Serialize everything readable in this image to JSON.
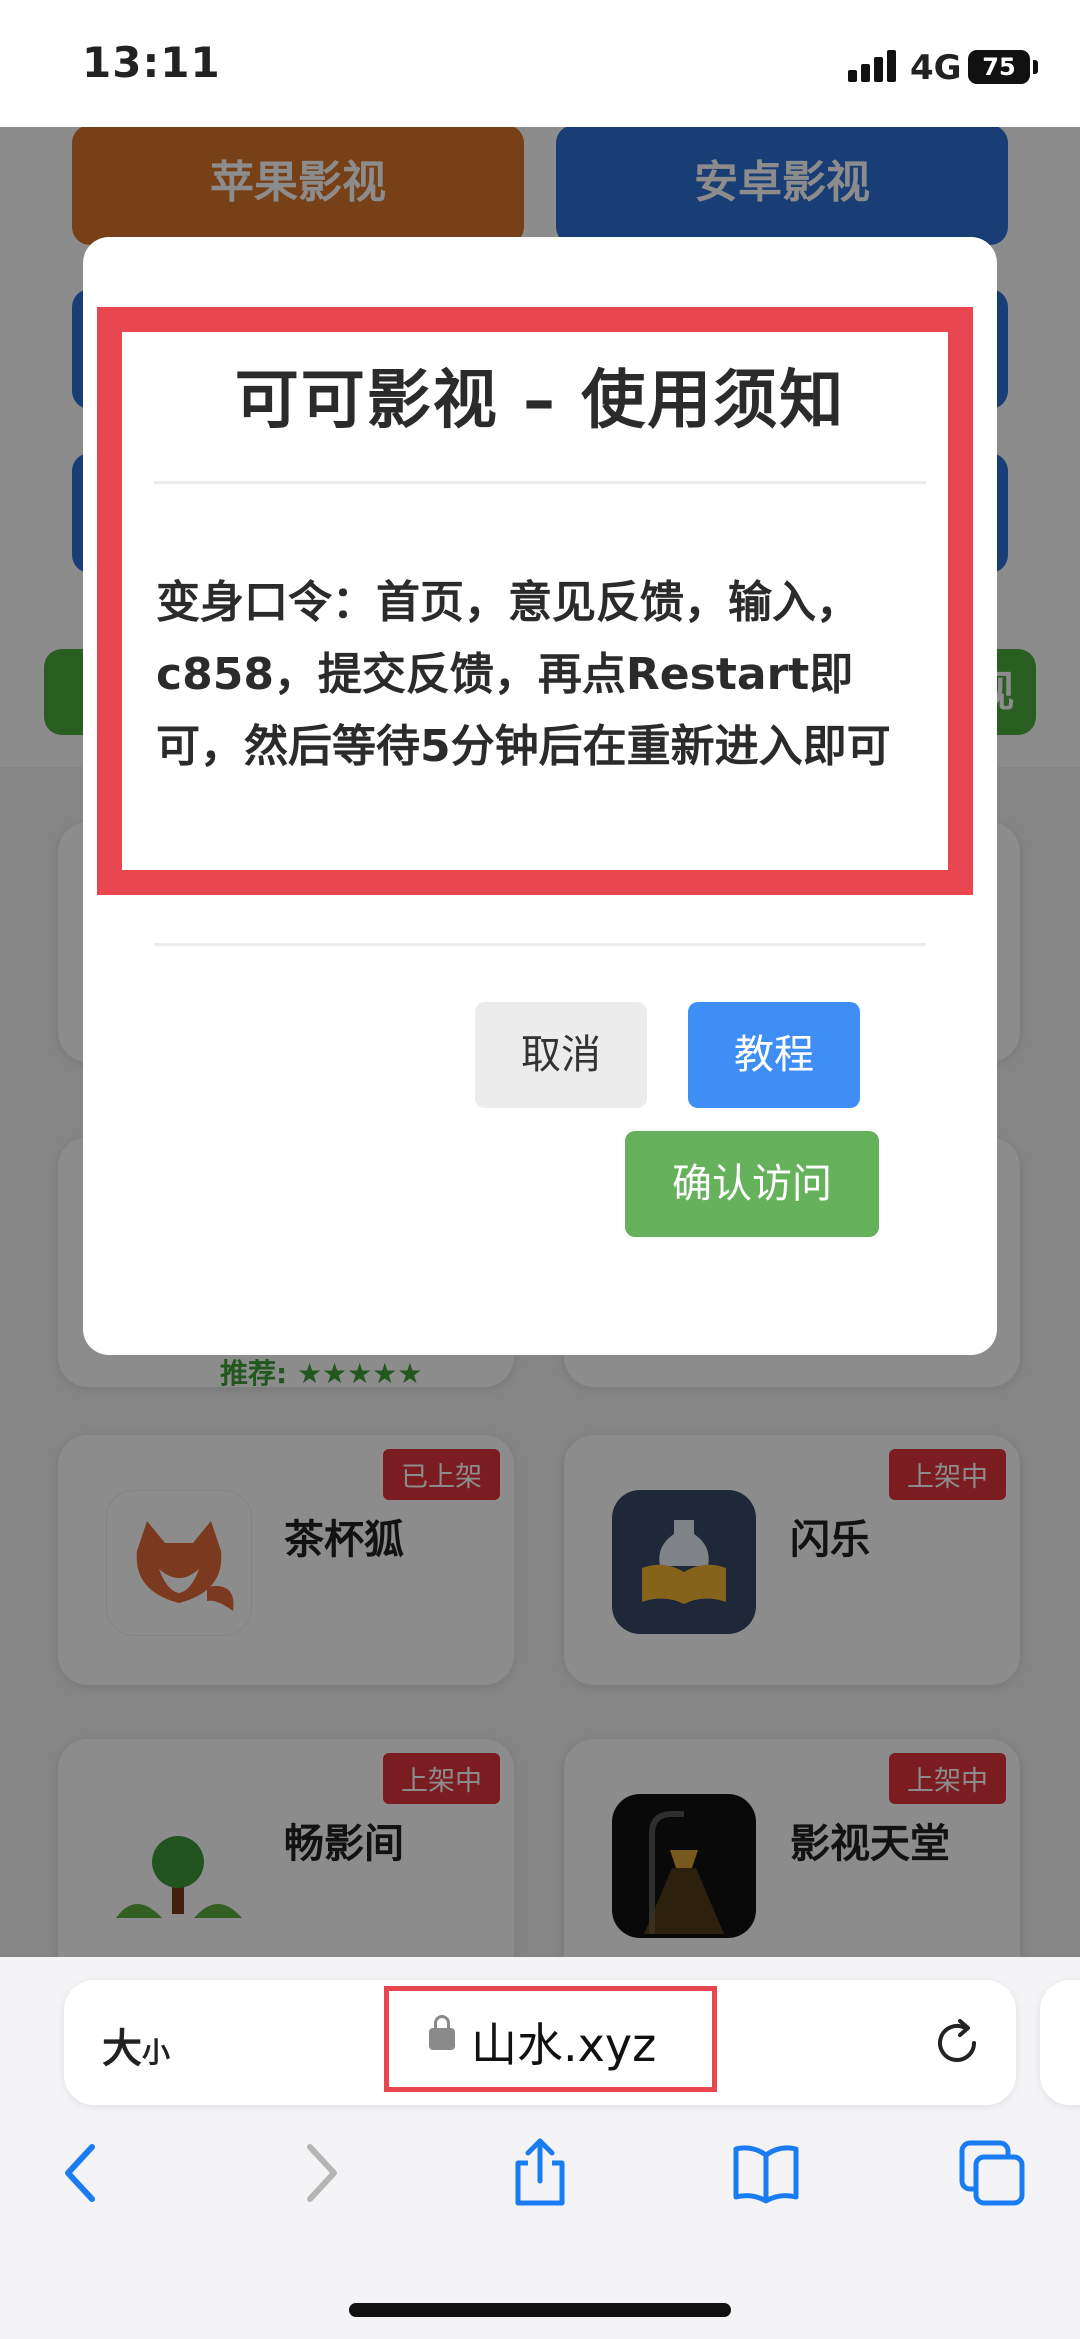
{
  "status_bar": {
    "time": "13:11",
    "network": "4G",
    "battery": "75"
  },
  "background": {
    "buttons": [
      "苹果影视",
      "安卓影视",
      "视"
    ],
    "cards": [
      {
        "name": "茶杯狐",
        "badge": "已上架"
      },
      {
        "name": "闪乐",
        "badge": "上架中"
      },
      {
        "name": "畅影间",
        "badge": "上架中"
      },
      {
        "name": "影视天堂",
        "badge": "上架中"
      }
    ],
    "rating_text": "推荐: ★★★★★"
  },
  "modal": {
    "title": "可可影视 – 使用须知",
    "body": "变身口令：首页，意见反馈，输入，c858，提交反馈，再点Restart即可，然后等待5分钟后在重新进入即可",
    "cancel": "取消",
    "tutorial": "教程",
    "confirm": "确认访问"
  },
  "browser": {
    "text_size_big": "大",
    "text_size_small": "小",
    "url": "山水.xyz"
  },
  "colors": {
    "highlight": "#e8474f",
    "tutorial_button": "#3f8ef6",
    "confirm_button": "#66b25c",
    "badge": "#e0333b",
    "ios_blue": "#1a7cf2"
  },
  "icons": [
    "signal-icon",
    "lock-icon",
    "reload-icon",
    "back-icon",
    "forward-icon",
    "share-icon",
    "bookmarks-icon",
    "tabs-icon"
  ]
}
